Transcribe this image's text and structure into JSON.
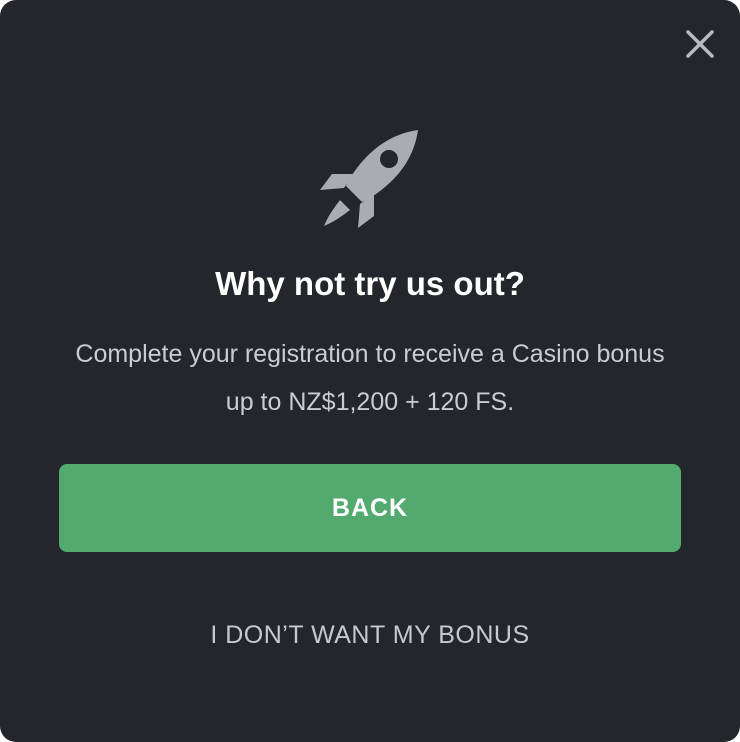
{
  "dialog": {
    "close_icon": "close-icon",
    "hero_icon": "rocket-icon",
    "title": "Why not try us out?",
    "description": "Complete your registration to receive a Casino bonus up to NZ$1,200 + 120 FS.",
    "back_label": "BACK",
    "decline_label": "I DON’T WANT MY BONUS"
  },
  "colors": {
    "background": "#23262b",
    "primary_button": "#52aa6e",
    "icon": "#a9adb3",
    "text_muted": "#c9ccd1"
  }
}
